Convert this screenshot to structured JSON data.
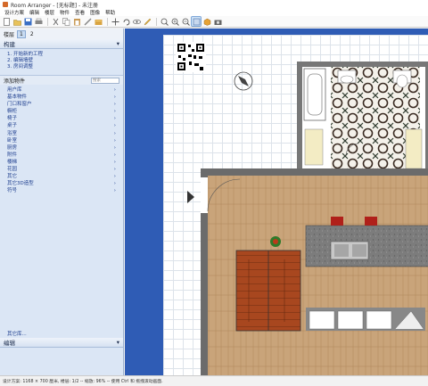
{
  "window": {
    "title": "Room Arranger - [无标题] - 未注册"
  },
  "menu": [
    "设计方案",
    "编辑",
    "楼层",
    "物件",
    "查看",
    "图像",
    "帮助"
  ],
  "toolbar": {
    "icons": [
      "new-icon",
      "open-icon",
      "save-icon",
      "print-icon",
      "cut-icon",
      "copy-icon",
      "paste-icon",
      "measure-icon",
      "folder-icon",
      "move-icon",
      "rotate-icon",
      "eye-icon",
      "pencil-icon",
      "zoom-fit-icon",
      "zoom-in-icon",
      "zoom-out-icon",
      "view-2d-icon",
      "view-3d-icon",
      "camera-icon"
    ]
  },
  "floors": {
    "label": "楼层",
    "tabs": [
      "1",
      "2"
    ],
    "active": "1"
  },
  "build": {
    "label": "构建",
    "steps": [
      "1. 开始新的工程",
      "2. 编辑墙壁",
      "3. 房间调整"
    ]
  },
  "add_objects": {
    "label": "添加物件",
    "search_placeholder": "搜索",
    "categories": [
      "用户库",
      "基本物件",
      "门口和窗户",
      "橱柜",
      "椅子",
      "桌子",
      "浴室",
      "卧室",
      "厨房",
      "附件",
      "楼梯",
      "花园",
      "其它",
      "其它3D造型",
      "符号"
    ],
    "more_label": "其它库..."
  },
  "edit": {
    "label": "编辑"
  },
  "status": {
    "text": "设计方案: 1168 × 700 厘米, 楼层: 1/2 -- 缩放: 96% -- 使用 Ctrl 和 拖拽滚动画面."
  },
  "colors": {
    "canvas_frame": "#2f5cb5",
    "panel": "#dbe6f5",
    "wall": "#6b6b6b",
    "floor_wood": "#c9a47a",
    "stairs": "#a8471f"
  }
}
